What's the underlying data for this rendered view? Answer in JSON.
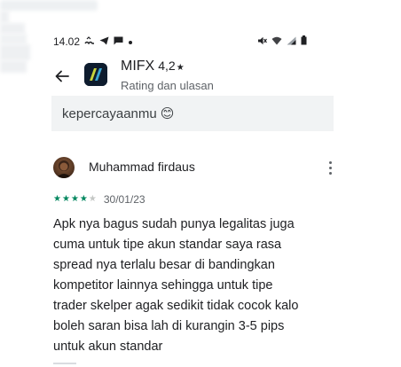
{
  "status_bar": {
    "time": "14.02"
  },
  "app_bar": {
    "app_name": "MIFX",
    "rating": "4,2",
    "rating_star": "★",
    "subtitle": "Rating dan ulasan"
  },
  "previous_reply": {
    "text": "kepercayaanmu",
    "emoji": "😊"
  },
  "review": {
    "reviewer_name": "Muhammad firdaus",
    "star_rating": 4,
    "stars": [
      "★",
      "★",
      "★",
      "★",
      "★"
    ],
    "date": "30/01/23",
    "lines": [
      "Apk nya bagus sudah punya legalitas juga",
      "cuma untuk tipe akun standar saya rasa",
      "spread nya terlalu besar di bandingkan",
      "kompetitor lainnya sehingga untuk tipe",
      "trader skelper agak sedikit tidak cocok kalo",
      "boleh saran bisa lah di kurangin 3-5 pips",
      "untuk akun standar"
    ]
  },
  "colors": {
    "star_active": "#01875f",
    "star_inactive": "#c4c7c5",
    "reply_background": "#f1f3f4",
    "app_icon_background": "#0e1c2e"
  }
}
